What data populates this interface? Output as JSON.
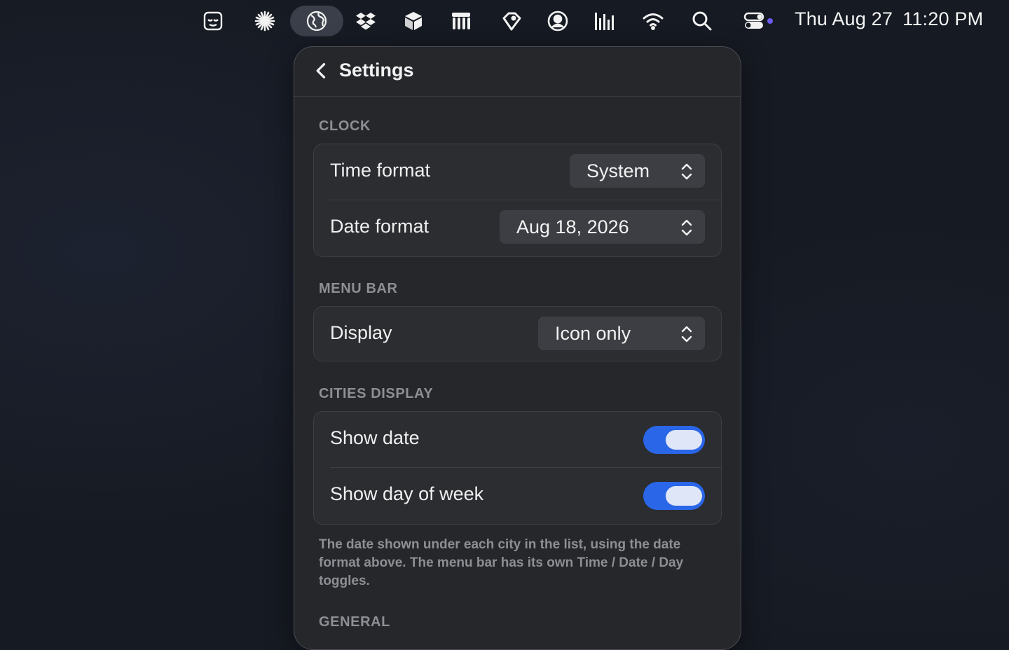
{
  "menubar": {
    "icons": [
      "sleepy-face-icon",
      "asterisk-icon",
      "globe-icon",
      "dropbox-icon",
      "cube-icon",
      "bars-app-icon",
      "tag-icon",
      "person-circle-icon",
      "equalizer-icon",
      "wifi-icon",
      "search-icon",
      "control-center-icon"
    ],
    "date": "Thu Aug 27",
    "time": "11:20 PM"
  },
  "panel": {
    "title": "Settings",
    "sections": {
      "clock": {
        "label": "CLOCK",
        "time_format_label": "Time format",
        "time_format_value": "System",
        "date_format_label": "Date format",
        "date_format_value": "Aug 18, 2026"
      },
      "menu_bar": {
        "label": "MENU BAR",
        "display_label": "Display",
        "display_value": "Icon only"
      },
      "cities_display": {
        "label": "CITIES DISPLAY",
        "show_date_label": "Show date",
        "show_date_on": true,
        "show_day_label": "Show day of week",
        "show_day_on": true,
        "footnote": "The date shown under each city in the list, using the date format above. The menu bar has its own Time / Date / Day toggles."
      },
      "general": {
        "label": "GENERAL"
      }
    }
  },
  "colors": {
    "accent": "#2a66e8",
    "panel_bg": "#25272b",
    "card_bg": "#2b2d31",
    "muted_text": "#8d8f94"
  }
}
